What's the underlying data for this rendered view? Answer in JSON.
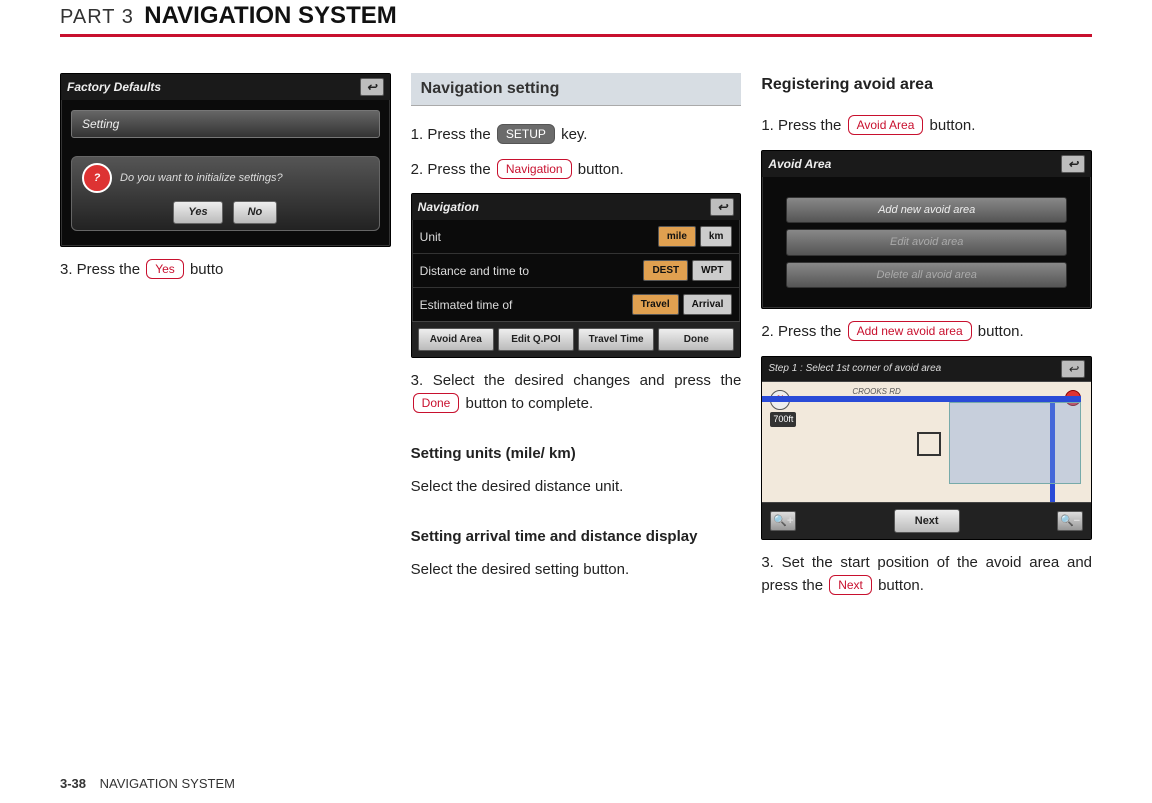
{
  "header": {
    "part": "PART 3",
    "title": "NAVIGATION SYSTEM"
  },
  "footer": {
    "page": "3-38",
    "section": "NAVIGATION SYSTEM"
  },
  "col1": {
    "shot_title": "Factory Defaults",
    "setting_bar": "Setting",
    "dialog_text": "Do you want to initialize settings?",
    "dlg_yes": "Yes",
    "dlg_no": "No",
    "step3_pre": "3. Press the ",
    "step3_btn": "Yes",
    "step3_post": " butto"
  },
  "col2": {
    "section_heading": "Navigation setting",
    "step1_pre": "1. Press the ",
    "step1_btn": "SETUP",
    "step1_post": " key.",
    "step2_pre": "2. Press the ",
    "step2_btn": "Navigation",
    "step2_post": " button.",
    "shot_title": "Navigation",
    "row_unit": "Unit",
    "unit_a": "mile",
    "unit_b": "km",
    "row_dist": "Distance and time to",
    "dist_a": "DEST",
    "dist_b": "WPT",
    "row_eta": "Estimated time of",
    "eta_a": "Travel",
    "eta_b": "Arrival",
    "bb1": "Avoid Area",
    "bb2": "Edit Q.POI",
    "bb3": "Travel Time",
    "bb4": "Done",
    "step3_pre": "3. Select the desired changes and press the ",
    "step3_btn": "Done",
    "step3_post": " button to complete.",
    "sub1_h": "Setting units (mile/ km)",
    "sub1_b": "Select the desired distance unit.",
    "sub2_h": "Setting arrival time and distance display",
    "sub2_b": "Select the desired setting button."
  },
  "col3": {
    "section_heading": "Registering avoid area",
    "step1_pre": "1. Press the ",
    "step1_btn": "Avoid Area",
    "step1_post": " button.",
    "shot1_title": "Avoid Area",
    "list1": "Add new avoid area",
    "list2": "Edit avoid area",
    "list3": "Delete all avoid area",
    "step2_pre": "2. Press the ",
    "step2_btn": "Add new avoid area",
    "step2_post": " button.",
    "shot2_title": "Step 1 : Select 1st corner of avoid area",
    "compass": "N",
    "zoom": "700ft",
    "road_label": "CROOKS RD",
    "zin": "+",
    "zout": "−",
    "next": "Next",
    "step3_pre": "3. Set the start position of the avoid area and press the ",
    "step3_btn": "Next",
    "step3_post": " button."
  }
}
